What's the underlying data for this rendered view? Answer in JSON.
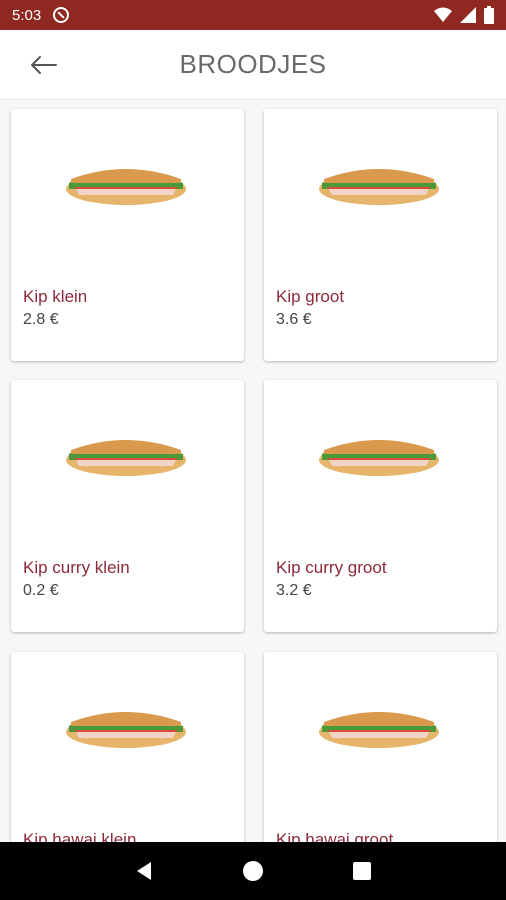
{
  "status_bar": {
    "time": "5:03",
    "icons": [
      "dnd-icon",
      "wifi-icon",
      "signal-icon",
      "battery-icon"
    ]
  },
  "app_bar": {
    "title": "BROODJES",
    "back_icon": "arrow-left-icon"
  },
  "products": [
    {
      "name": "Kip klein",
      "price": "2.8  €",
      "image": "sandwich-image"
    },
    {
      "name": "Kip groot",
      "price": "3.6  €",
      "image": "sandwich-image"
    },
    {
      "name": "Kip curry klein",
      "price": "0.2  €",
      "image": "sandwich-image"
    },
    {
      "name": "Kip curry groot",
      "price": "3.2  €",
      "image": "sandwich-image"
    },
    {
      "name": "Kip hawai klein",
      "price": "",
      "image": "sandwich-image"
    },
    {
      "name": "Kip hawai groot",
      "price": "",
      "image": "sandwich-image"
    }
  ],
  "nav_bar": {
    "icons": [
      "back-triangle-icon",
      "home-circle-icon",
      "recents-square-icon"
    ]
  },
  "colors": {
    "status_bar": "#8e2820",
    "product_name": "#8b2a3a",
    "title": "#6a6a6a"
  }
}
